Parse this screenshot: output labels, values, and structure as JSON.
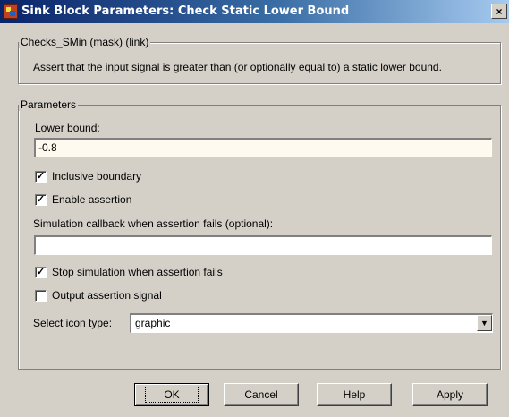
{
  "window": {
    "title": "Sink Block Parameters: Check Static  Lower Bound",
    "close_label": "×"
  },
  "mask_group": {
    "legend": "Checks_SMin (mask) (link)",
    "description": "Assert that the input signal is greater than (or optionally equal to) a static lower bound."
  },
  "parameters": {
    "legend": "Parameters",
    "lower_bound_label": "Lower bound:",
    "lower_bound_value": "-0.8",
    "inclusive_boundary": {
      "label": "Inclusive boundary",
      "checked": true,
      "mark": "✓"
    },
    "enable_assertion": {
      "label": "Enable assertion",
      "checked": true,
      "mark": "✓"
    },
    "callback_label": "Simulation callback when assertion fails (optional):",
    "callback_value": "",
    "stop_simulation": {
      "label": "Stop simulation when assertion fails",
      "checked": true,
      "mark": "✓"
    },
    "output_signal": {
      "label": "Output assertion signal",
      "checked": false,
      "mark": ""
    },
    "icon_type_label": "Select icon type:",
    "icon_type_value": "graphic",
    "dropdown_arrow": "▼"
  },
  "buttons": {
    "ok": "OK",
    "cancel": "Cancel",
    "help": "Help",
    "apply": "Apply"
  }
}
